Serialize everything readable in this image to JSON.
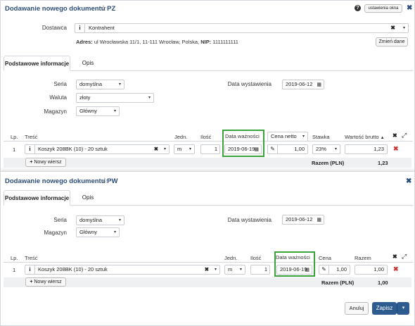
{
  "pz": {
    "title": "Dodawanie nowego dokumentu PZ",
    "settings_label": "ustawienia okna",
    "help_glyph": "?",
    "close_glyph": "✖",
    "star_glyph": "☆",
    "supplier_label": "Dostawca",
    "supplier_value": "Kontrahent",
    "info_glyph": "i",
    "address_prefix": "Adres:",
    "address_text": "ul Wrocławska 11/1, 11-111 Wrocław, Polska,",
    "nip_label": "NIP:",
    "nip_value": "1111111111",
    "change_data_label": "Zmień dane",
    "tabs": [
      {
        "label": "Podstawowe informacje"
      },
      {
        "label": "Opis"
      }
    ],
    "series_label": "Seria",
    "series_value": "domyślna",
    "currency_label": "Waluta",
    "currency_value": "złoty",
    "warehouse_label": "Magazyn",
    "warehouse_value": "Główny",
    "issue_date_label": "Data wystawienia",
    "issue_date_value": "2019-06-12",
    "table": {
      "headers": {
        "lp": "Lp.",
        "content": "Treść",
        "unit": "Jedn.",
        "qty": "Ilość",
        "expiry": "Data ważności",
        "price_mode": "Cena netto",
        "rate": "Stawka",
        "gross": "Wartość brutto"
      },
      "row": {
        "lp": "1",
        "content": "Koszyk 208BK (10) - 20 sztuk",
        "unit": "m",
        "qty": "1",
        "expiry": "2019-06-19",
        "price": "1,00",
        "rate": "23%",
        "gross": "1,23"
      },
      "new_row_label": "Nowy wiersz",
      "total_label": "Razem (PLN)",
      "total_value": "1,23"
    }
  },
  "pw": {
    "title": "Dodawanie nowego dokumentu PW",
    "star_glyph": "☆",
    "close_glyph": "✖",
    "tabs": [
      {
        "label": "Podstawowe informacje"
      },
      {
        "label": "Opis"
      }
    ],
    "series_label": "Seria",
    "series_value": "domyślna",
    "warehouse_label": "Magazyn",
    "warehouse_value": "Główny",
    "issue_date_label": "Data wystawienia",
    "issue_date_value": "2019-06-12",
    "table": {
      "headers": {
        "lp": "Lp.",
        "content": "Treść",
        "unit": "Jedn.",
        "qty": "Ilość",
        "expiry": "Data ważności",
        "price": "Cena",
        "amount": "Razem"
      },
      "row": {
        "lp": "1",
        "content": "Koszyk 208BK (10) - 20 sztuk",
        "unit": "m",
        "qty": "1",
        "expiry": "2019-06-19",
        "price": "1,00",
        "amount": "1,00"
      },
      "new_row_label": "Nowy wiersz",
      "total_label": "Razem (PLN)",
      "total_value": "1,00"
    },
    "cancel_label": "Anuluj",
    "save_label": "Zapisz"
  },
  "icons": {
    "caret": "▾",
    "times": "✖",
    "plus": "+",
    "pencil": "✎",
    "calendar": "▦",
    "expand": "⤢"
  },
  "colors": {
    "accent": "#2d5b8f",
    "highlight": "#3aa33a",
    "danger": "#c33333"
  }
}
